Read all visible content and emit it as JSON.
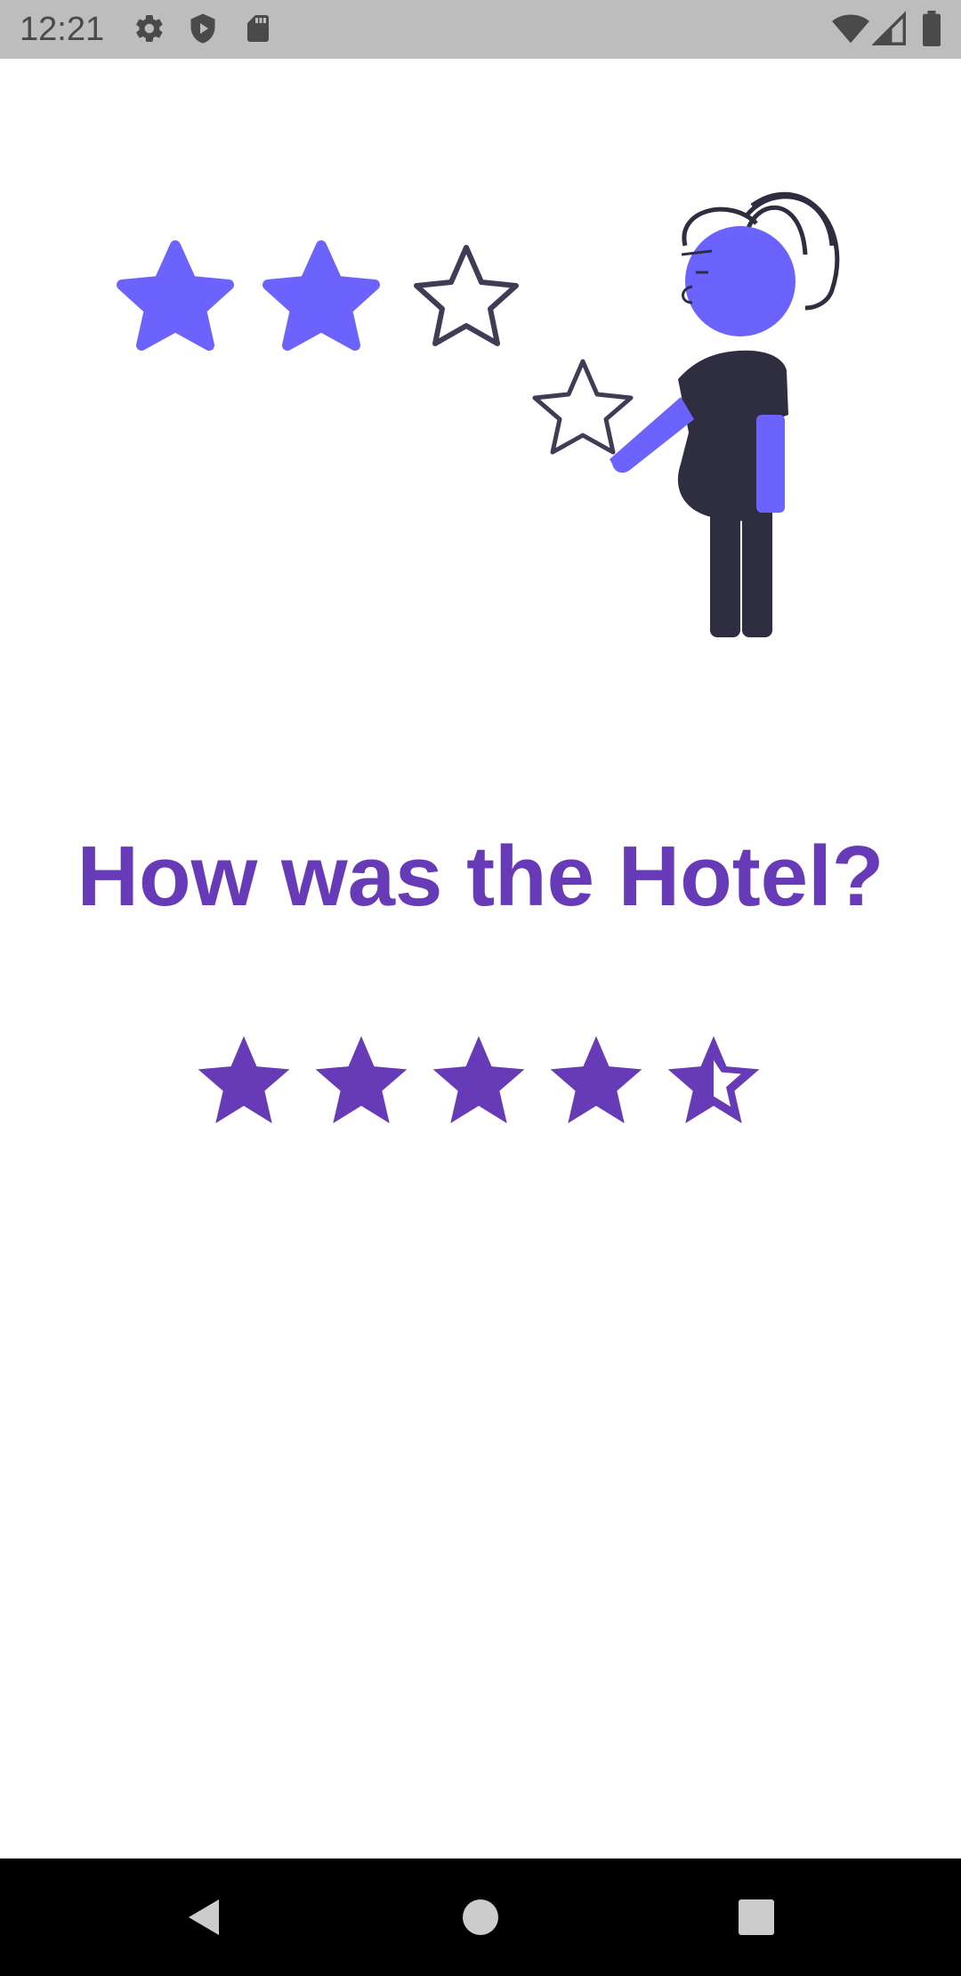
{
  "status_bar": {
    "time": "12:21",
    "left_icons": [
      "gear-icon",
      "shield-icon",
      "sd-card-icon"
    ],
    "right_icons": [
      "wifi-icon",
      "cell-signal-icon",
      "battery-icon"
    ]
  },
  "illustration": {
    "scene": "person-holding-star",
    "stars_filled": 2,
    "stars_total": 3,
    "colors": {
      "accent": "#6c63ff",
      "dark": "#2f2e41",
      "outline": "#3f3d56"
    }
  },
  "question": {
    "title": "How was the Hotel?"
  },
  "rating": {
    "value": 4.5,
    "max": 5,
    "color": "#673ab7"
  },
  "nav_bar": {
    "buttons": [
      "back-icon",
      "home-icon",
      "recents-icon"
    ]
  }
}
